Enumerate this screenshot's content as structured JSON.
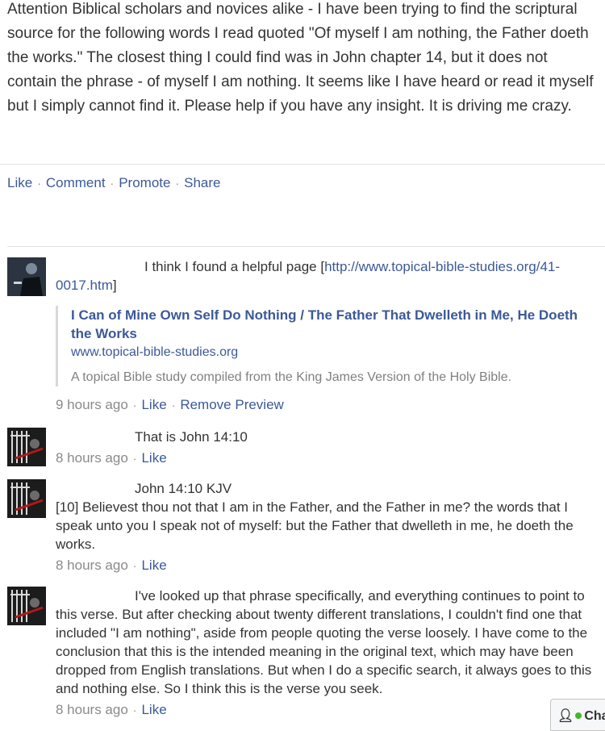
{
  "post": {
    "text": "Attention Biblical scholars and novices alike - I have been trying to find the scriptural source for the following words I read quoted \"Of myself I am nothing, the Father doeth the works.\" The closest thing I could find was in John chapter 14, but it does not contain the phrase - of myself I am nothing. It seems like I have heard or read it myself but I simply cannot find it. Please help if you have any insight. It is driving me crazy.",
    "actions": [
      "Like",
      "Comment",
      "Promote",
      "Share"
    ]
  },
  "comments": [
    {
      "text": "I think I found a helpful page [",
      "link": "http://www.topical-bible-studies.org/41-0017.htm",
      "text_after": "]",
      "preview": {
        "title": "I Can of Mine Own Self Do Nothing / The Father That Dwelleth in Me, He Doeth the Works",
        "domain": "www.topical-bible-studies.org",
        "description": "A topical Bible study compiled from the King James Version of the Holy Bible."
      },
      "time": "9 hours ago",
      "actions": [
        "Like",
        "Remove Preview"
      ]
    },
    {
      "text": "That is John 14:10",
      "time": "8 hours ago",
      "actions": [
        "Like"
      ]
    },
    {
      "text": "John 14:10 KJV",
      "text2": "[10] Believest thou not that I am in the Father, and the Father in me? the words that I speak unto you I speak not of myself: but the Father that dwelleth in me, he doeth the works.",
      "time": "8 hours ago",
      "actions": [
        "Like"
      ]
    },
    {
      "text": "I've looked up that phrase specifically, and everything continues to point to this verse. But after checking about twenty different translations, I couldn't find one that included \"I am nothing\", aside from people quoting the verse loosely. I have come to the conclusion that this is the intended meaning in the original text, which may have been dropped from English translations. But when I do a specific search, it always goes to this and nothing else. So I think this is the verse you seek.",
      "time": "8 hours ago",
      "actions": [
        "Like"
      ]
    }
  ],
  "chat": {
    "label": "Cha"
  }
}
